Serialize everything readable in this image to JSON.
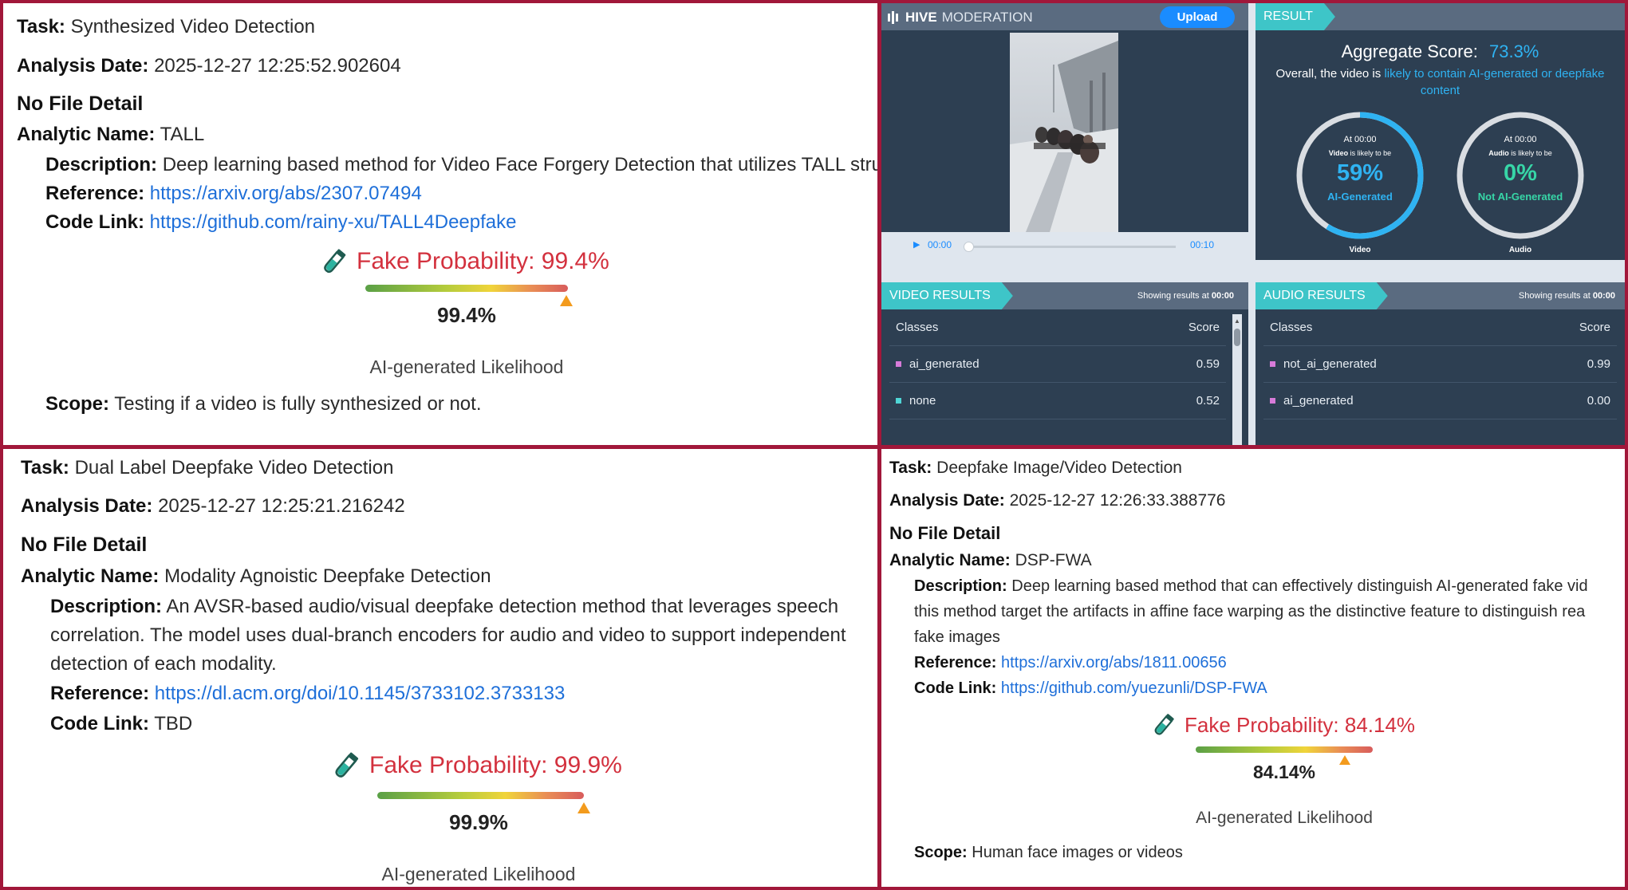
{
  "reports": {
    "tall": {
      "task_label": "Task:",
      "task": "Synthesized Video Detection",
      "date_label": "Analysis Date:",
      "date": "2025-12-27 12:25:52.902604",
      "file_detail": "No File Detail",
      "analytic_label": "Analytic Name:",
      "analytic": "TALL",
      "description_label": "Description:",
      "description": "Deep learning based method for Video Face Forgery Detection that utilizes TALL struc",
      "reference_label": "Reference:",
      "reference": "https://arxiv.org/abs/2307.07494",
      "code_label": "Code Link:",
      "code": "https://github.com/rainy-xu/TALL4Deepfake",
      "fake_probability": "Fake Probability: 99.4%",
      "gauge_fraction": 0.994,
      "percent": "99.4%",
      "likelihood_label": "AI-generated Likelihood",
      "scope_label": "Scope:",
      "scope": "Testing if a video is fully synthesized or not."
    },
    "dual": {
      "task_label": "Task:",
      "task": "Dual Label Deepfake Video Detection",
      "date_label": "Analysis Date:",
      "date": "2025-12-27 12:25:21.216242",
      "file_detail": "No File Detail",
      "analytic_label": "Analytic Name:",
      "analytic": "Modality Agnoistic Deepfake Detection",
      "description_label": "Description:",
      "description": "An AVSR-based audio/visual deepfake detection method that leverages speech correlation. The model uses dual-branch encoders for audio and video to support independent detection of each modality.",
      "reference_label": "Reference:",
      "reference": "https://dl.acm.org/doi/10.1145/3733102.3733133",
      "code_label": "Code Link:",
      "code": "TBD",
      "fake_probability": "Fake Probability: 99.9%",
      "gauge_fraction": 0.999,
      "percent": "99.9%",
      "likelihood_label": "AI-generated Likelihood"
    },
    "dsp": {
      "task_label": "Task:",
      "task": "Deepfake Image/Video Detection",
      "date_label": "Analysis Date:",
      "date": "2025-12-27 12:26:33.388776",
      "file_detail": "No File Detail",
      "analytic_label": "Analytic Name:",
      "analytic": "DSP-FWA",
      "description_label": "Description:",
      "description_line1": "Deep learning based method that can effectively distinguish AI-generated fake vid",
      "description_line2": "this method target the artifacts in affine face warping as the distinctive feature to distinguish rea",
      "description_line3": "fake images",
      "reference_label": "Reference:",
      "reference": "https://arxiv.org/abs/1811.00656",
      "code_label": "Code Link:",
      "code": "https://github.com/yuezunli/DSP-FWA",
      "fake_probability": "Fake Probability: 84.14%",
      "gauge_fraction": 0.8414,
      "percent": "84.14%",
      "likelihood_label": "AI-generated Likelihood",
      "scope_label": "Scope:",
      "scope": "Human face images or videos"
    }
  },
  "hive": {
    "brand_strong": "HIVE",
    "brand_light": "MODERATION",
    "upload_label": "Upload",
    "time_current": "00:00",
    "time_total": "00:10",
    "result_tag": "RESULT",
    "aggregate_label": "Aggregate Score:",
    "aggregate_value": "73.3%",
    "overall_prefix": "Overall, the video is",
    "overall_highlight": "likely to contain AI-generated or deepfake content",
    "video_dial": {
      "at": "At 00:00",
      "subject_strong": "Video",
      "subject_rest": "is likely to be",
      "value": "59%",
      "verdict": "AI-Generated",
      "fraction": 0.59,
      "caption": "Video"
    },
    "audio_dial": {
      "at": "At 00:00",
      "subject_strong": "Audio",
      "subject_rest": "is likely to be",
      "value": "0%",
      "verdict": "Not AI-Generated",
      "fraction": 0.0,
      "caption": "Audio"
    },
    "video_results": {
      "tag": "VIDEO RESULTS",
      "showing_prefix": "Showing results at",
      "showing_time": "00:00",
      "col_classes": "Classes",
      "col_score": "Score",
      "rows": [
        {
          "cls": "ai_generated",
          "score": "0.59",
          "color": "#d77bd9"
        },
        {
          "cls": "none",
          "score": "0.52",
          "color": "#4fd6d6"
        }
      ]
    },
    "audio_results": {
      "tag": "AUDIO RESULTS",
      "showing_prefix": "Showing results at",
      "showing_time": "00:00",
      "col_classes": "Classes",
      "col_score": "Score",
      "rows": [
        {
          "cls": "not_ai_generated",
          "score": "0.99",
          "color": "#d77bd9"
        },
        {
          "cls": "ai_generated",
          "score": "0.00",
          "color": "#d77bd9"
        }
      ]
    },
    "accent_blue": "#2fb3f2",
    "accent_green": "#37d6a7",
    "card_bg": "#2d3f52"
  }
}
